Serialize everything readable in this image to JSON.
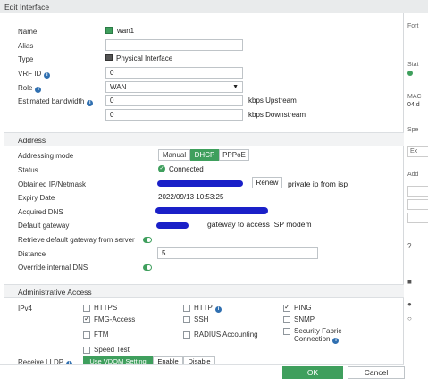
{
  "title": "Edit Interface",
  "fields": {
    "name_label": "Name",
    "name_value": "wan1",
    "alias_label": "Alias",
    "alias_value": "",
    "type_label": "Type",
    "type_value": "Physical Interface",
    "vrf_label": "VRF ID",
    "vrf_value": "0",
    "role_label": "Role",
    "role_value": "WAN",
    "bw_label": "Estimated bandwidth",
    "bw_up_value": "0",
    "bw_up_unit": "kbps Upstream",
    "bw_down_value": "0",
    "bw_down_unit": "kbps Downstream"
  },
  "address": {
    "section_title": "Address",
    "mode_label": "Addressing mode",
    "modes": [
      "Manual",
      "DHCP",
      "PPPoE"
    ],
    "active_mode": "DHCP",
    "status_label": "Status",
    "status_value": "Connected",
    "obtained_label": "Obtained IP/Netmask",
    "renew_label": "Renew",
    "obtained_note": "private ip from isp",
    "expiry_label": "Expiry Date",
    "expiry_value": "2022/09/13 10:53:25",
    "dns_label": "Acquired DNS",
    "gateway_label": "Default gateway",
    "gateway_note": "gateway to access ISP modem",
    "retrieve_label": "Retrieve default gateway from server",
    "retrieve_on": true,
    "distance_label": "Distance",
    "distance_value": "5",
    "override_label": "Override internal DNS",
    "override_on": true
  },
  "admin": {
    "section_title": "Administrative Access",
    "ipv4_label": "IPv4",
    "options": [
      {
        "label": "HTTPS",
        "checked": false
      },
      {
        "label": "HTTP",
        "checked": false
      },
      {
        "label": "PING",
        "checked": true
      },
      {
        "label": "FMG-Access",
        "checked": true
      },
      {
        "label": "SSH",
        "checked": false
      },
      {
        "label": "SNMP",
        "checked": false
      },
      {
        "label": "FTM",
        "checked": false
      },
      {
        "label": "RADIUS Accounting",
        "checked": false
      },
      {
        "label": "Security Fabric Connection",
        "checked": false
      },
      {
        "label": "Speed Test",
        "checked": false
      }
    ],
    "lldp_label": "Receive LLDP",
    "lldp_options": [
      "Use VDOM Setting",
      "Enable",
      "Disable"
    ]
  },
  "footer": {
    "ok_label": "OK",
    "cancel_label": "Cancel"
  },
  "side": {
    "t1": "Fort",
    "t2": "Stat",
    "t3": "MAC",
    "t4": "04:d",
    "t5": "Spe",
    "t6": "Ex",
    "t7": "Add"
  },
  "colors": {
    "accent_green": "#3f9f5d",
    "redaction_blue": "#1a20c8",
    "info_blue": "#2f6fb0"
  }
}
